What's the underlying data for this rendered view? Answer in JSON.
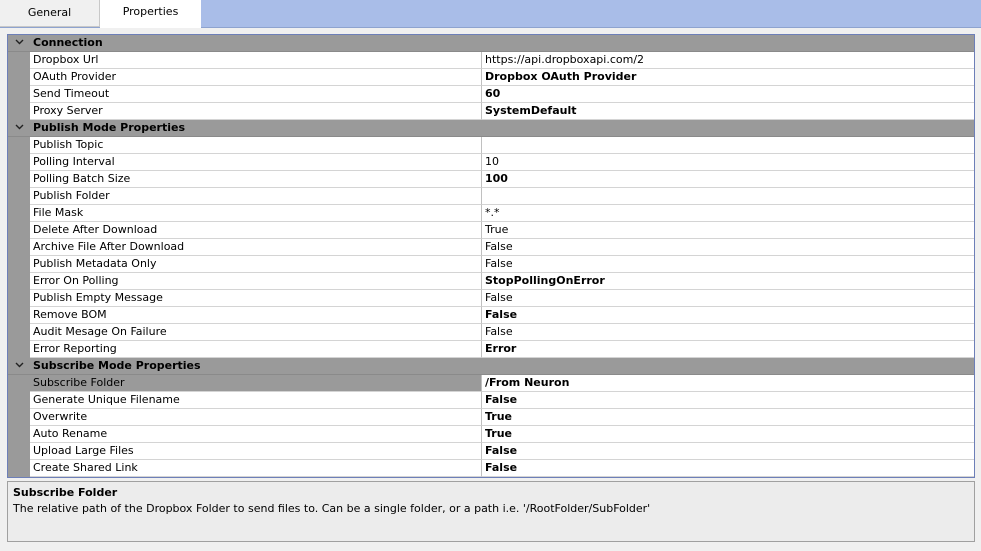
{
  "tabs": [
    "General",
    "Properties"
  ],
  "categories": [
    {
      "label": "Connection",
      "rows": [
        {
          "name": "Dropbox Url",
          "value": "https://api.dropboxapi.com/2",
          "bold": false
        },
        {
          "name": "OAuth Provider",
          "value": "Dropbox OAuth Provider",
          "bold": true
        },
        {
          "name": "Send Timeout",
          "value": "60",
          "bold": true
        },
        {
          "name": "Proxy Server",
          "value": "SystemDefault",
          "bold": true
        }
      ]
    },
    {
      "label": "Publish Mode Properties",
      "rows": [
        {
          "name": "Publish Topic",
          "value": "",
          "bold": false
        },
        {
          "name": "Polling Interval",
          "value": "10",
          "bold": false
        },
        {
          "name": "Polling Batch Size",
          "value": "100",
          "bold": true
        },
        {
          "name": "Publish Folder",
          "value": "",
          "bold": false
        },
        {
          "name": "File Mask",
          "value": "*.*",
          "bold": false
        },
        {
          "name": "Delete After Download",
          "value": "True",
          "bold": false
        },
        {
          "name": "Archive File After Download",
          "value": "False",
          "bold": false
        },
        {
          "name": "Publish Metadata Only",
          "value": "False",
          "bold": false
        },
        {
          "name": "Error On Polling",
          "value": "StopPollingOnError",
          "bold": true
        },
        {
          "name": "Publish Empty Message",
          "value": "False",
          "bold": false
        },
        {
          "name": "Remove BOM",
          "value": "False",
          "bold": true
        },
        {
          "name": "Audit Mesage On Failure",
          "value": "False",
          "bold": false
        },
        {
          "name": "Error Reporting",
          "value": "Error",
          "bold": true
        }
      ]
    },
    {
      "label": "Subscribe Mode Properties",
      "rows": [
        {
          "name": "Subscribe Folder",
          "value": "/From Neuron",
          "bold": true,
          "selected": true
        },
        {
          "name": "Generate Unique Filename",
          "value": "False",
          "bold": true
        },
        {
          "name": "Overwrite",
          "value": "True",
          "bold": true
        },
        {
          "name": "Auto Rename",
          "value": "True",
          "bold": true
        },
        {
          "name": "Upload Large Files",
          "value": "False",
          "bold": true
        },
        {
          "name": "Create Shared Link",
          "value": "False",
          "bold": true
        }
      ]
    }
  ],
  "description": {
    "title": "Subscribe Folder",
    "text": "The relative path of the Dropbox Folder to send files to. Can be a single folder, or a path i.e. '/RootFolder/SubFolder'"
  },
  "colors": {
    "tab_strip": "#a9bde8",
    "category_header": "#9a9a9a",
    "grid_border": "#6d7fb8"
  },
  "icons": {
    "category_toggle": "chevron-down-icon"
  }
}
